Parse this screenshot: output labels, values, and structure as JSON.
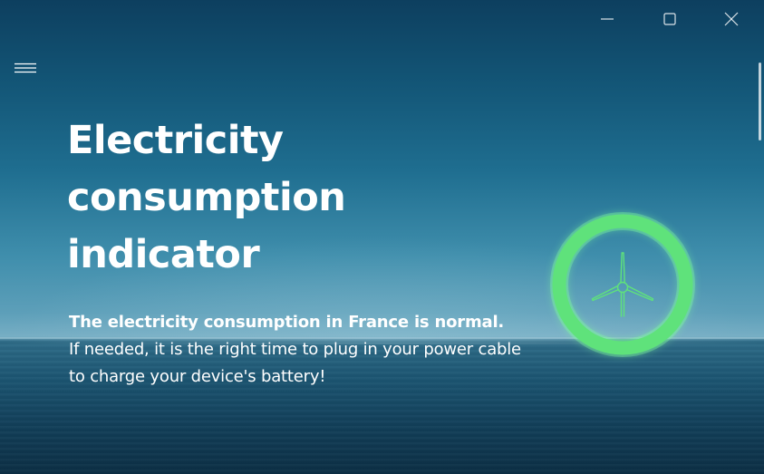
{
  "window": {
    "controls": {
      "minimize_icon": "minimize-icon",
      "maximize_icon": "maximize-icon",
      "close_icon": "close-icon"
    },
    "menu_icon": "hamburger-menu-icon"
  },
  "main": {
    "title_lines": [
      "Electricity",
      "consumption",
      "indicator"
    ],
    "status_message": "The electricity consumption in France is normal.",
    "advice_message": "If needed, it is the right time to plug in your power cable to charge your device's battery!"
  },
  "indicator": {
    "status": "normal",
    "icon": "wind-turbine-icon",
    "ring_color": "#5fe27b",
    "glow_color": "#7dff9a"
  }
}
